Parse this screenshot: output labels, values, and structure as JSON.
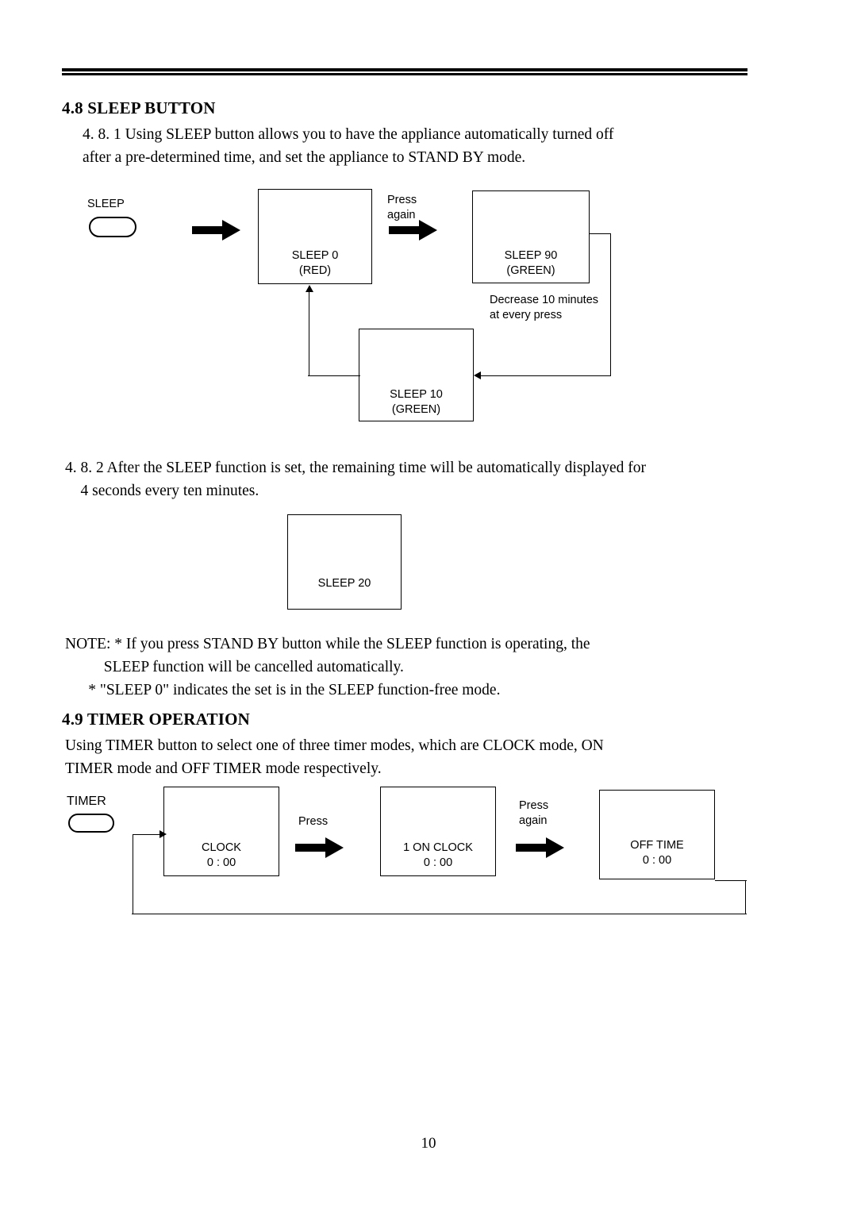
{
  "document": {
    "page_number": "10",
    "sections": [
      {
        "heading": "4.8 SLEEP BUTTON",
        "paragraphs": [
          "4. 8. 1 Using SLEEP button allows you to have the appliance automatically turned off\nafter a pre-determined time, and set the appliance to STAND BY mode.",
          "4. 8. 2 After the SLEEP function is set, the remaining time will be automatically displayed for\n    4 seconds every ten minutes.",
          "NOTE: * If you press STAND BY button while the SLEEP function is operating, the\n          SLEEP function will be cancelled automatically.\n      * \"SLEEP 0\" indicates the set is in the SLEEP function-free mode."
        ]
      },
      {
        "heading": "4.9 TIMER OPERATION",
        "paragraphs": [
          "Using TIMER button to select one of three timer modes, which are CLOCK mode, ON\nTIMER mode and OFF TIMER mode respectively."
        ]
      }
    ]
  },
  "sleep_diagram": {
    "button_label": "SLEEP",
    "boxes": [
      {
        "line1": "SLEEP 0",
        "line2": "(RED)"
      },
      {
        "line1": "SLEEP 90",
        "line2": "(GREEN)"
      },
      {
        "line1": "SLEEP 10",
        "line2": "(GREEN)"
      }
    ],
    "annotations": [
      "Press\nagain",
      "Decrease 10 minutes\nat every press"
    ]
  },
  "sleep_display": {
    "box_label": "SLEEP 20"
  },
  "timer_diagram": {
    "button_label": "TIMER",
    "boxes": [
      {
        "line1": "CLOCK",
        "line2": "0 : 00"
      },
      {
        "line1": "1 ON CLOCK",
        "line2": "0 : 00"
      },
      {
        "line1": "OFF TIME",
        "line2": "0 : 00"
      }
    ],
    "annotations": [
      "Press",
      "Press\nagain"
    ]
  }
}
